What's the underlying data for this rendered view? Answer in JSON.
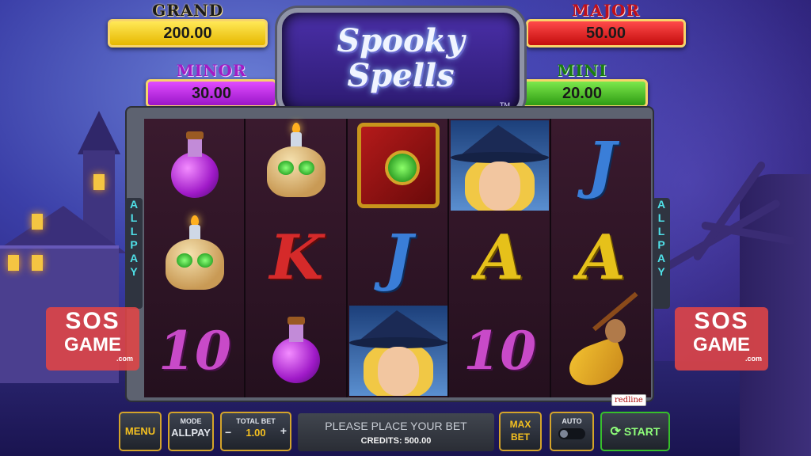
{
  "jackpots": {
    "grand": {
      "label": "GRAND",
      "value": "200.00"
    },
    "major": {
      "label": "MAJOR",
      "value": "50.00"
    },
    "minor": {
      "label": "MINOR",
      "value": "30.00"
    },
    "mini": {
      "label": "MINI",
      "value": "20.00"
    }
  },
  "logo": {
    "line1": "Spooky",
    "line2": "Spells",
    "tm": "TM"
  },
  "side_label": [
    "A",
    "L",
    "L",
    "P",
    "A",
    "Y"
  ],
  "reels": [
    [
      "potion",
      "skull",
      "10"
    ],
    [
      "skull",
      "K",
      "potion"
    ],
    [
      "book",
      "J",
      "witch"
    ],
    [
      "witch",
      "A",
      "10"
    ],
    [
      "J",
      "A",
      "broom"
    ]
  ],
  "watermark": {
    "line1": "SOS",
    "line2": "GAME",
    "line3": ".com"
  },
  "controls": {
    "menu": "MENU",
    "mode_label": "MODE",
    "mode_value": "ALLPAY",
    "total_bet_label": "TOTAL BET",
    "total_bet_value": "1.00",
    "status_message": "PLEASE PLACE YOUR BET",
    "credits": "CREDITS: 500.00",
    "max_bet_line1": "MAX",
    "max_bet_line2": "BET",
    "auto_label": "AUTO",
    "start": "START",
    "brand": "redline"
  },
  "colors": {
    "gold": "#d4a42a",
    "allpay_text": "#4fe0e8",
    "start_border": "#37c02a"
  }
}
